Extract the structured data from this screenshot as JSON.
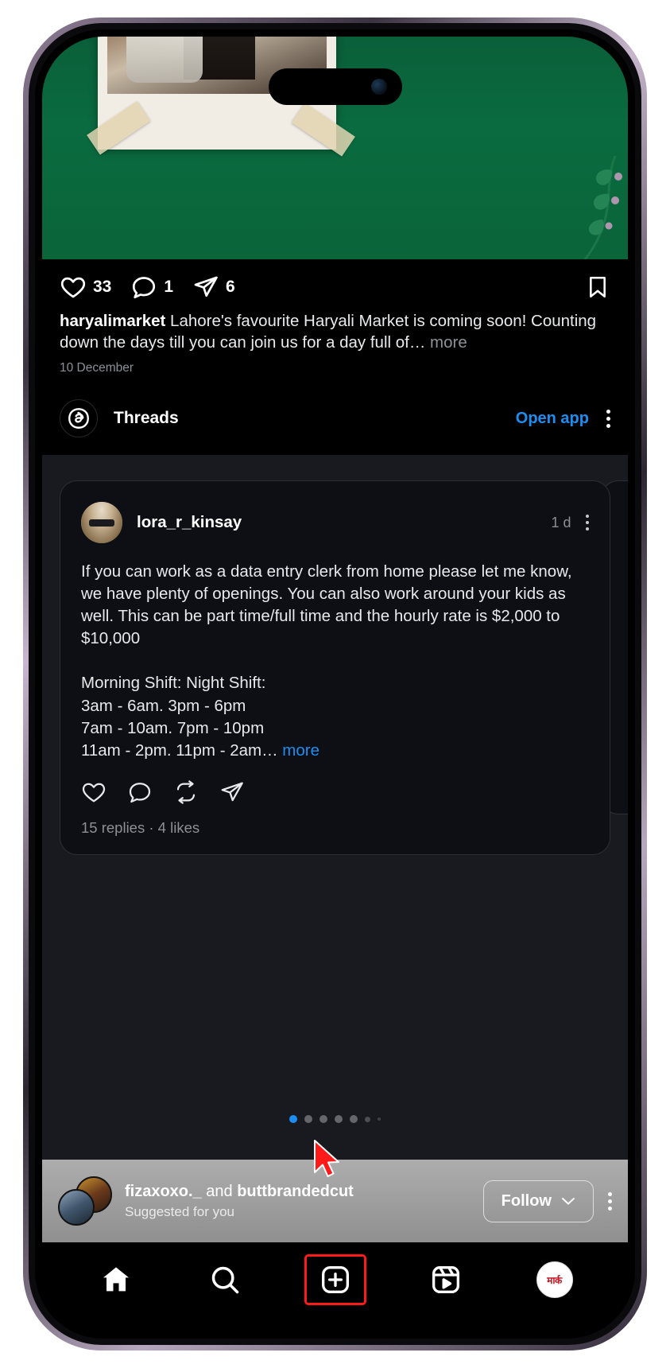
{
  "post": {
    "likes": "33",
    "comments": "1",
    "shares": "6",
    "caption_user": "haryalimarket",
    "caption_text": " Lahore's favourite Haryali Market is coming soon! Counting down the days till you can join us for a day full of…",
    "caption_more": " more",
    "date": "10 December",
    "icons": {
      "like": "heart-icon",
      "comment": "comment-icon",
      "share": "share-icon",
      "save": "bookmark-icon"
    }
  },
  "threads": {
    "app_name": "Threads",
    "open_app_label": "Open app",
    "logo_icon": "threads-logo-icon",
    "menu_icon": "more-options-icon"
  },
  "thread_card": {
    "username": "lora_r_kinsay",
    "timestamp": "1 d",
    "body": "If you can work as a data entry clerk from home please let me know, we have plenty of openings. You can also work around your kids as well. This can be part time/full time and the hourly rate is $2,000 to $10,000\n\nMorning Shift: Night Shift:\n3am - 6am. 3pm - 6pm\n7am - 10am. 7pm - 10pm\n11am - 2pm. 11pm - 2am…",
    "more_label": " more",
    "replies": "15 replies",
    "dot_separator": "·",
    "likes": "4 likes",
    "icons": {
      "like": "heart-icon",
      "reply": "comment-icon",
      "repost": "repost-icon",
      "share": "share-icon",
      "menu": "more-options-icon"
    }
  },
  "carousel": {
    "total_dots": 7,
    "active_index": 0
  },
  "suggested": {
    "names_first": "fizaxoxo._",
    "names_join": " and ",
    "names_second": "buttbrandedcut",
    "subtitle": "Suggested for you",
    "follow_label": "Follow",
    "chevron_icon": "chevron-down-icon",
    "menu_icon": "more-options-icon"
  },
  "navbar": {
    "items": [
      {
        "name": "home",
        "icon": "home-icon"
      },
      {
        "name": "search",
        "icon": "search-icon"
      },
      {
        "name": "create",
        "icon": "plus-square-icon"
      },
      {
        "name": "reels",
        "icon": "reels-icon"
      },
      {
        "name": "profile",
        "icon": "profile-avatar-icon"
      }
    ],
    "profile_initials": "मार्क"
  },
  "colors": {
    "accent_blue": "#1c8ef2",
    "highlight_red": "#ff1a1a",
    "post_bg_green": "#0a6b40",
    "card_bg": "#0d0f14",
    "carousel_bg": "#191a20"
  }
}
